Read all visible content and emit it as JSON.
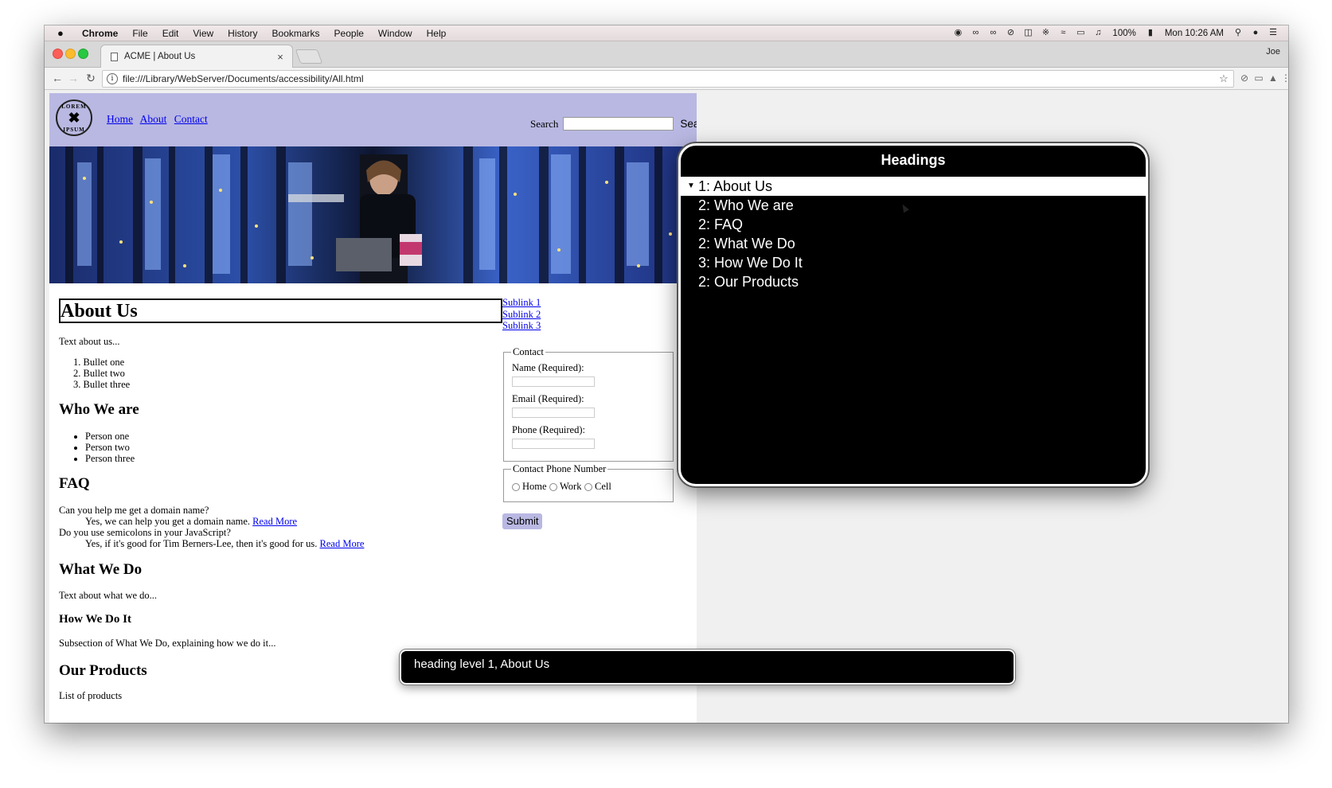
{
  "menubar": {
    "apple": "",
    "items": [
      "Chrome",
      "File",
      "Edit",
      "View",
      "History",
      "Bookmarks",
      "People",
      "Window",
      "Help"
    ],
    "battery": "100%",
    "clock": "Mon 10:26 AM"
  },
  "browser": {
    "tab_title": "ACME | About Us",
    "tab_close": "×",
    "profile": "Joe",
    "url": "file:///Library/WebServer/Documents/accessibility/All.html"
  },
  "site": {
    "logo_top": "LOREM",
    "logo_bottom": "IPSUM",
    "nav": [
      "Home",
      "About",
      "Contact"
    ],
    "search_label": "Search",
    "search_button": "Search",
    "h1": "About Us",
    "text_about": "Text about us...",
    "ordered_list": [
      "1. Bullet one",
      "2. Bullet two",
      "3. Bullet three"
    ],
    "h2_who": "Who We are",
    "people": [
      "Person one",
      "Person two",
      "Person three"
    ],
    "h2_faq": "FAQ",
    "faq_q1": "Can you help me get a domain name?",
    "faq_a1": "Yes, we can help you get a domain name.",
    "faq_q2": "Do you use semicolons in your JavaScript?",
    "faq_a2": "Yes, if it's good for Tim Berners-Lee, then it's good for us.",
    "read_more": "Read More",
    "h2_what": "What We Do",
    "text_what": "Text about what we do...",
    "h3_how": "How We Do It",
    "text_how": "Subsection of What We Do, explaining how we do it...",
    "h2_products": "Our Products",
    "text_products": "List of products",
    "sublinks": [
      "Sublink 1",
      "Sublink 2",
      "Sublink 3"
    ],
    "contact_legend": "Contact",
    "name_label": "Name (Required):",
    "email_label": "Email (Required):",
    "phone_label": "Phone (Required):",
    "phone_legend": "Contact Phone Number",
    "radio_home": "Home",
    "radio_work": "Work",
    "radio_cell": "Cell",
    "submit": "Submit"
  },
  "rotor": {
    "title": "Headings",
    "items": [
      "1: About Us",
      "2: Who We are",
      "2: FAQ",
      "2: What We Do",
      "3: How We Do It",
      "2: Our Products"
    ],
    "selected_index": 0
  },
  "caption": {
    "text": "heading level 1, About Us"
  },
  "colors": {
    "header_bg": "#b9b8e2",
    "link": "#0000ee",
    "rotor_bg": "#000000"
  }
}
